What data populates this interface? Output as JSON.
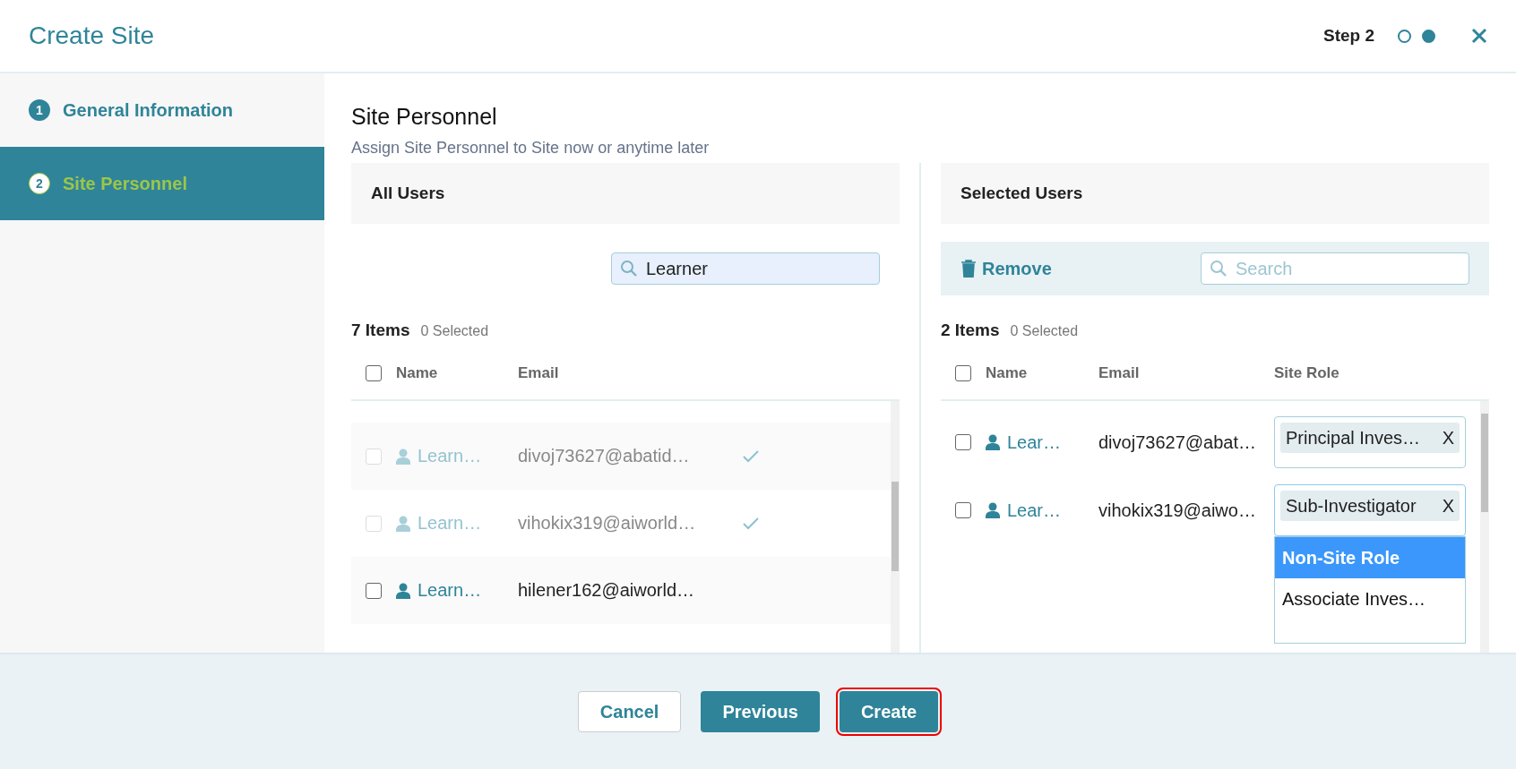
{
  "window": {
    "title": "Create Site",
    "step": "Step 2",
    "step_dots": [
      {
        "selected": false
      },
      {
        "selected": true
      }
    ]
  },
  "sidebar": {
    "items": [
      {
        "number": "1",
        "label": "General Information",
        "selected": false
      },
      {
        "number": "2",
        "label": "Site Personnel",
        "selected": true
      }
    ]
  },
  "section": {
    "title": "Site Personnel",
    "subtitle": "Assign Site Personnel to Site now or anytime later"
  },
  "all_users": {
    "title": "All Users",
    "search": {
      "value": "Learner"
    },
    "count": "7 Items",
    "selected_count": "0 Selected",
    "select_all_checked": false,
    "columns": [
      "Name",
      "Email"
    ],
    "rows": [
      {
        "name": "Learn…",
        "email": "divoj73627@abatid…",
        "disabled": true,
        "added": true,
        "checked": false
      },
      {
        "name": "Learn…",
        "email": "vihokix319@aiworld…",
        "disabled": true,
        "added": true,
        "checked": false
      },
      {
        "name": "Learn…",
        "email": "hilener162@aiworld…",
        "disabled": false,
        "added": false,
        "checked": false
      }
    ]
  },
  "selected_users": {
    "title": "Selected Users",
    "remove": "Remove",
    "search": {
      "placeholder": "Search"
    },
    "count": "2 Items",
    "selected_count": "0 Selected",
    "select_all_checked": false,
    "columns": [
      "Name",
      "Email",
      "Site Role"
    ],
    "rows": [
      {
        "name": "Lear…",
        "email": "divoj73627@abat…",
        "role": "Principal Inves…",
        "role_clear": "X",
        "checked": false,
        "expanded": false
      },
      {
        "name": "Lear…",
        "email": "vihokix319@aiwo…",
        "role": "Sub-Investigator",
        "role_clear": "X",
        "checked": false,
        "expanded": true,
        "options": [
          {
            "label": "Non-Site Role",
            "selected": true
          },
          {
            "label": "Associate Inves…",
            "selected": false
          }
        ]
      }
    ]
  },
  "buttons": [
    {
      "label": "Cancel",
      "kind": "secondary",
      "focused": false
    },
    {
      "label": "Previous",
      "kind": "primary",
      "focused": false
    },
    {
      "label": "Create",
      "kind": "primary",
      "focused": true
    }
  ]
}
